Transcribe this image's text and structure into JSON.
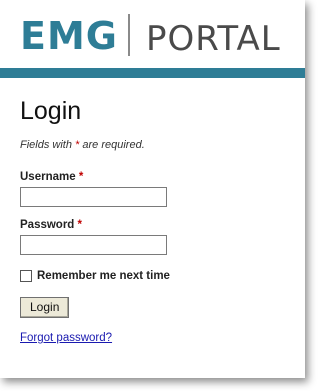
{
  "header": {
    "logo_emg": "EMG",
    "logo_portal": "PORTAL",
    "brand_color": "#2e7d96"
  },
  "form": {
    "title": "Login",
    "required_note_prefix": "Fields with",
    "required_marker": "*",
    "required_note_suffix": "are required.",
    "username_label": "Username",
    "username_value": "",
    "password_label": "Password",
    "password_value": "",
    "remember_label": "Remember me next time",
    "remember_checked": false,
    "submit_label": "Login",
    "forgot_link": "Forgot password?"
  }
}
